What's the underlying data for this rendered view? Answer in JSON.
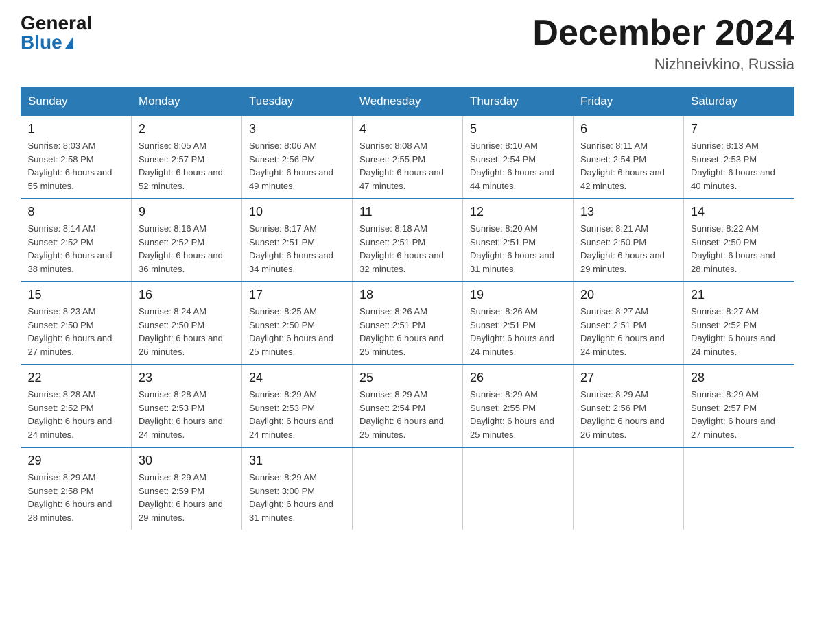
{
  "logo": {
    "general": "General",
    "blue": "Blue"
  },
  "title": "December 2024",
  "location": "Nizhneivkino, Russia",
  "days_header": [
    "Sunday",
    "Monday",
    "Tuesday",
    "Wednesday",
    "Thursday",
    "Friday",
    "Saturday"
  ],
  "weeks": [
    [
      {
        "day": "1",
        "sunrise": "8:03 AM",
        "sunset": "2:58 PM",
        "daylight": "6 hours and 55 minutes."
      },
      {
        "day": "2",
        "sunrise": "8:05 AM",
        "sunset": "2:57 PM",
        "daylight": "6 hours and 52 minutes."
      },
      {
        "day": "3",
        "sunrise": "8:06 AM",
        "sunset": "2:56 PM",
        "daylight": "6 hours and 49 minutes."
      },
      {
        "day": "4",
        "sunrise": "8:08 AM",
        "sunset": "2:55 PM",
        "daylight": "6 hours and 47 minutes."
      },
      {
        "day": "5",
        "sunrise": "8:10 AM",
        "sunset": "2:54 PM",
        "daylight": "6 hours and 44 minutes."
      },
      {
        "day": "6",
        "sunrise": "8:11 AM",
        "sunset": "2:54 PM",
        "daylight": "6 hours and 42 minutes."
      },
      {
        "day": "7",
        "sunrise": "8:13 AM",
        "sunset": "2:53 PM",
        "daylight": "6 hours and 40 minutes."
      }
    ],
    [
      {
        "day": "8",
        "sunrise": "8:14 AM",
        "sunset": "2:52 PM",
        "daylight": "6 hours and 38 minutes."
      },
      {
        "day": "9",
        "sunrise": "8:16 AM",
        "sunset": "2:52 PM",
        "daylight": "6 hours and 36 minutes."
      },
      {
        "day": "10",
        "sunrise": "8:17 AM",
        "sunset": "2:51 PM",
        "daylight": "6 hours and 34 minutes."
      },
      {
        "day": "11",
        "sunrise": "8:18 AM",
        "sunset": "2:51 PM",
        "daylight": "6 hours and 32 minutes."
      },
      {
        "day": "12",
        "sunrise": "8:20 AM",
        "sunset": "2:51 PM",
        "daylight": "6 hours and 31 minutes."
      },
      {
        "day": "13",
        "sunrise": "8:21 AM",
        "sunset": "2:50 PM",
        "daylight": "6 hours and 29 minutes."
      },
      {
        "day": "14",
        "sunrise": "8:22 AM",
        "sunset": "2:50 PM",
        "daylight": "6 hours and 28 minutes."
      }
    ],
    [
      {
        "day": "15",
        "sunrise": "8:23 AM",
        "sunset": "2:50 PM",
        "daylight": "6 hours and 27 minutes."
      },
      {
        "day": "16",
        "sunrise": "8:24 AM",
        "sunset": "2:50 PM",
        "daylight": "6 hours and 26 minutes."
      },
      {
        "day": "17",
        "sunrise": "8:25 AM",
        "sunset": "2:50 PM",
        "daylight": "6 hours and 25 minutes."
      },
      {
        "day": "18",
        "sunrise": "8:26 AM",
        "sunset": "2:51 PM",
        "daylight": "6 hours and 25 minutes."
      },
      {
        "day": "19",
        "sunrise": "8:26 AM",
        "sunset": "2:51 PM",
        "daylight": "6 hours and 24 minutes."
      },
      {
        "day": "20",
        "sunrise": "8:27 AM",
        "sunset": "2:51 PM",
        "daylight": "6 hours and 24 minutes."
      },
      {
        "day": "21",
        "sunrise": "8:27 AM",
        "sunset": "2:52 PM",
        "daylight": "6 hours and 24 minutes."
      }
    ],
    [
      {
        "day": "22",
        "sunrise": "8:28 AM",
        "sunset": "2:52 PM",
        "daylight": "6 hours and 24 minutes."
      },
      {
        "day": "23",
        "sunrise": "8:28 AM",
        "sunset": "2:53 PM",
        "daylight": "6 hours and 24 minutes."
      },
      {
        "day": "24",
        "sunrise": "8:29 AM",
        "sunset": "2:53 PM",
        "daylight": "6 hours and 24 minutes."
      },
      {
        "day": "25",
        "sunrise": "8:29 AM",
        "sunset": "2:54 PM",
        "daylight": "6 hours and 25 minutes."
      },
      {
        "day": "26",
        "sunrise": "8:29 AM",
        "sunset": "2:55 PM",
        "daylight": "6 hours and 25 minutes."
      },
      {
        "day": "27",
        "sunrise": "8:29 AM",
        "sunset": "2:56 PM",
        "daylight": "6 hours and 26 minutes."
      },
      {
        "day": "28",
        "sunrise": "8:29 AM",
        "sunset": "2:57 PM",
        "daylight": "6 hours and 27 minutes."
      }
    ],
    [
      {
        "day": "29",
        "sunrise": "8:29 AM",
        "sunset": "2:58 PM",
        "daylight": "6 hours and 28 minutes."
      },
      {
        "day": "30",
        "sunrise": "8:29 AM",
        "sunset": "2:59 PM",
        "daylight": "6 hours and 29 minutes."
      },
      {
        "day": "31",
        "sunrise": "8:29 AM",
        "sunset": "3:00 PM",
        "daylight": "6 hours and 31 minutes."
      },
      null,
      null,
      null,
      null
    ]
  ]
}
